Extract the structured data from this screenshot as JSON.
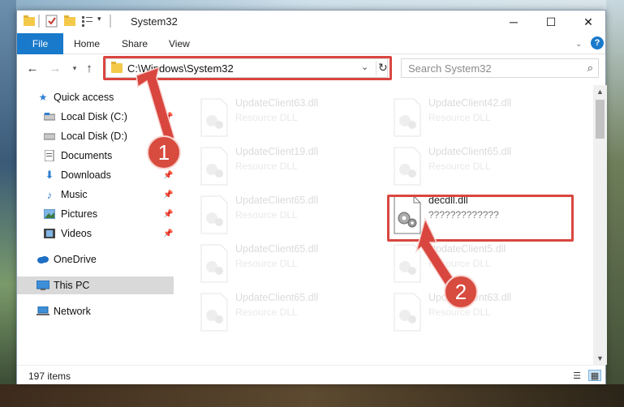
{
  "window": {
    "title": "System32",
    "controls": {
      "minimize": "─",
      "maximize": "☐",
      "close": "✕"
    }
  },
  "ribbon": {
    "tabs": [
      "File",
      "Home",
      "Share",
      "View"
    ],
    "help": "?"
  },
  "navigation": {
    "path": "C:\\Windows\\System32",
    "search_placeholder": "Search System32"
  },
  "sidebar": {
    "items": [
      {
        "label": "Quick access",
        "icon": "star-icon",
        "pinned": false
      },
      {
        "label": "Local Disk (C:)",
        "icon": "drive-icon",
        "pinned": true
      },
      {
        "label": "Local Disk (D:)",
        "icon": "drive-icon",
        "pinned": true
      },
      {
        "label": "Documents",
        "icon": "documents-icon",
        "pinned": true
      },
      {
        "label": "Downloads",
        "icon": "download-icon",
        "pinned": true
      },
      {
        "label": "Music",
        "icon": "music-icon",
        "pinned": true
      },
      {
        "label": "Pictures",
        "icon": "pictures-icon",
        "pinned": true
      },
      {
        "label": "Videos",
        "icon": "videos-icon",
        "pinned": true
      },
      {
        "label": "OneDrive",
        "icon": "cloud-icon",
        "pinned": false
      },
      {
        "label": "This PC",
        "icon": "computer-icon",
        "pinned": false,
        "selected": true
      },
      {
        "label": "Network",
        "icon": "network-icon",
        "pinned": false
      }
    ]
  },
  "files": [
    {
      "name": "UpdateClient63.dll",
      "type": "Resource DLL",
      "faded": true
    },
    {
      "name": "UpdateClient42.dll",
      "type": "Resource DLL",
      "faded": true
    },
    {
      "name": "UpdateClient19.dll",
      "type": "Resource DLL",
      "faded": true
    },
    {
      "name": "UpdateClient65.dll",
      "type": "Resource DLL",
      "faded": true
    },
    {
      "name": "UpdateClient65.dll",
      "type": "Resource DLL",
      "faded": true
    },
    {
      "name": "decdll.dll",
      "type": "?????????????",
      "faded": false
    },
    {
      "name": "UpdateClient65.dll",
      "type": "Resource DLL",
      "faded": true
    },
    {
      "name": "UpdateClient5.dll",
      "type": "Resource DLL",
      "faded": true
    },
    {
      "name": "UpdateClient65.dll",
      "type": "Resource DLL",
      "faded": true
    },
    {
      "name": "UpdateClient63.dll",
      "type": "Resource DLL",
      "faded": true
    }
  ],
  "status": {
    "item_count": "197 items"
  },
  "annotations": {
    "step1": "1",
    "step2": "2",
    "color": "#d9463f"
  },
  "colors": {
    "accent": "#1979ca",
    "folder": "#f4c94a",
    "highlight": "#d9463f"
  }
}
